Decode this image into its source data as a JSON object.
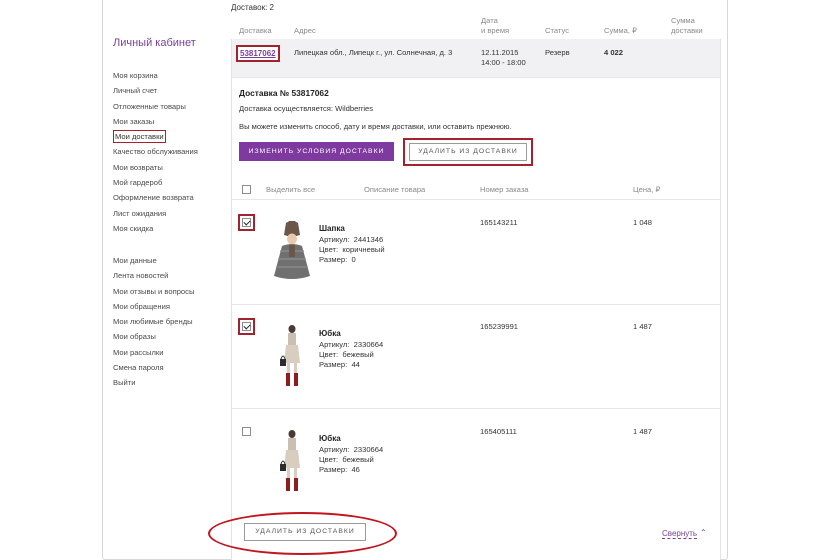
{
  "sidebar": {
    "title": "Личный кабинет",
    "menu1": [
      "Моя корзина",
      "Личный счет",
      "Отложенные товары",
      "Мои заказы",
      "Мои доставки",
      "Качество обслуживания",
      "Мои возвраты",
      "Мой гардероб",
      "Оформление возврата",
      "Лист ожидания",
      "Моя скидка"
    ],
    "menu2": [
      "Мои данные",
      "Лента новостей",
      "Мои отзывы и вопросы",
      "Мои обращения",
      "Мои любимые бренды",
      "Мои образы",
      "Мои рассылки",
      "Смена пароля",
      "Выйти"
    ]
  },
  "main": {
    "count_label": "Доставок: 2",
    "headers": {
      "delivery": "Доставка",
      "address": "Адрес",
      "date1": "Дата",
      "date2": "и время",
      "status": "Статус",
      "sum": "Сумма, ₽",
      "sum_del1": "Сумма",
      "sum_del2": "доставки"
    },
    "delivery_row": {
      "number": "53817062",
      "address": "Липецкая обл., Липецк г., ул. Солнечная, д. 3",
      "date": "12.11.2015",
      "time": "14:00 - 18:00",
      "status": "Резерв",
      "sum": "4 022"
    },
    "details": {
      "title": "Доставка № 53817062",
      "carrier": "Доставка осуществляется: Wildberries",
      "note": "Вы можете изменить способ, дату и время доставки, или оставить прежнюю.",
      "change_button": "ИЗМЕНИТЬ УСЛОВИЯ ДОСТАВКИ",
      "remove_button": "УДАЛИТЬ ИЗ ДОСТАВКИ"
    },
    "table": {
      "select_all": "Выделить все",
      "description": "Описание товара",
      "order_number": "Номер заказа",
      "price": "Цена, ₽"
    },
    "items": [
      {
        "name": "Шапка",
        "article_label": "Артикул:",
        "article": "2441346",
        "color_label": "Цвет:",
        "color": "коричневый",
        "size_label": "Размер:",
        "size": "0",
        "order": "165143211",
        "price": "1 048",
        "checked": true
      },
      {
        "name": "Юбка",
        "article_label": "Артикул:",
        "article": "2330664",
        "color_label": "Цвет:",
        "color": "бежевый",
        "size_label": "Размер:",
        "size": "44",
        "order": "165239991",
        "price": "1 487",
        "checked": true
      },
      {
        "name": "Юбка",
        "article_label": "Артикул:",
        "article": "2330664",
        "color_label": "Цвет:",
        "color": "бежевый",
        "size_label": "Размер:",
        "size": "46",
        "order": "165405111",
        "price": "1 487",
        "checked": false
      }
    ],
    "bottom_remove_button": "УДАЛИТЬ ИЗ ДОСТАВКИ",
    "collapse_link": "Свернуть",
    "collapse_icon": "chevron-up-icon"
  },
  "colors": {
    "accent": "#7f3a9f",
    "highlight": "#a3222f"
  }
}
